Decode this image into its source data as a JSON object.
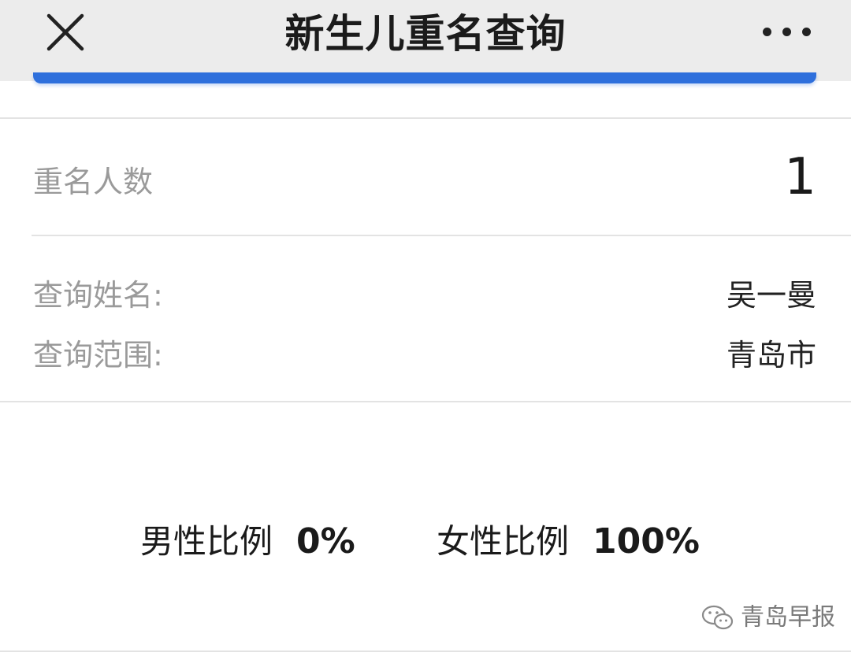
{
  "header": {
    "title": "新生儿重名查询",
    "close_icon": "close-icon",
    "more_icon": "more-options-icon"
  },
  "result": {
    "count_label": "重名人数",
    "count_value": "1",
    "name_label": "查询姓名:",
    "name_value": "吴一曼",
    "scope_label": "查询范围:",
    "scope_value": "青岛市"
  },
  "ratio": {
    "male_label": "男性比例",
    "male_value": "0%",
    "female_label": "女性比例",
    "female_value": "100%"
  },
  "watermark": {
    "icon": "wechat-icon",
    "text": "青岛早报"
  },
  "colors": {
    "accent": "#2e6fdc",
    "header_bg": "#ececec"
  }
}
